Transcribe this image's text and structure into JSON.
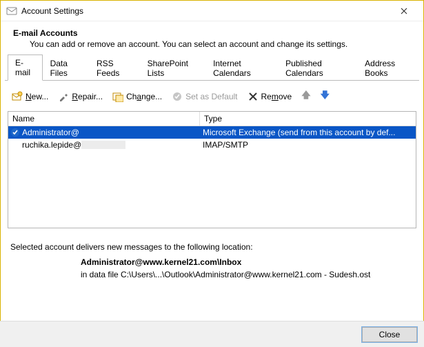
{
  "window": {
    "title": "Account Settings"
  },
  "header": {
    "title": "E-mail Accounts",
    "subtitle": "You can add or remove an account. You can select an account and change its settings."
  },
  "tabs": [
    {
      "label": "E-mail",
      "active": true
    },
    {
      "label": "Data Files"
    },
    {
      "label": "RSS Feeds"
    },
    {
      "label": "SharePoint Lists"
    },
    {
      "label": "Internet Calendars"
    },
    {
      "label": "Published Calendars"
    },
    {
      "label": "Address Books"
    }
  ],
  "toolbar": {
    "new": "New...",
    "repair": "Repair...",
    "change": "Change...",
    "set_default": "Set as Default",
    "remove": "Remove"
  },
  "columns": {
    "name": "Name",
    "type": "Type"
  },
  "accounts": [
    {
      "name": "Administrator@",
      "name_suffix_hidden": true,
      "type": "Microsoft Exchange (send from this account by def...",
      "default": true,
      "selected": true
    },
    {
      "name": "ruchika.lepide@",
      "name_suffix_hidden": true,
      "type": "IMAP/SMTP",
      "default": false,
      "selected": false
    }
  ],
  "location": {
    "intro": "Selected account delivers new messages to the following location:",
    "main": "Administrator@www.kernel21.com\\Inbox",
    "file": "in data file C:\\Users\\...\\Outlook\\Administrator@www.kernel21.com - Sudesh.ost"
  },
  "footer": {
    "close": "Close"
  }
}
